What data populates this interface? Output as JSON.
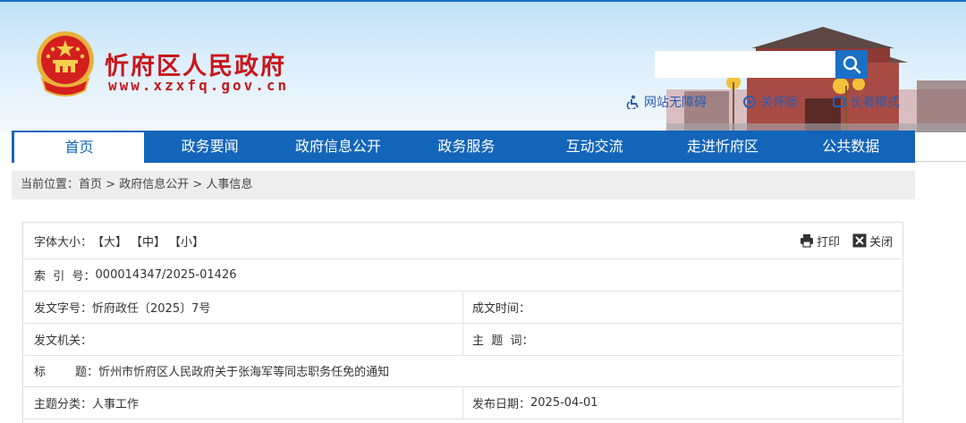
{
  "site": {
    "name": "忻府区人民政府",
    "url": "www.xzxfq.gov.cn"
  },
  "search": {
    "placeholder": ""
  },
  "quick_links": [
    {
      "label": "网站无障碍",
      "icon": "accessibility-icon"
    },
    {
      "label": "关怀版",
      "icon": "care-mode-icon"
    },
    {
      "label": "长者模式",
      "icon": "elder-mode-icon"
    }
  ],
  "nav": [
    {
      "label": "首页"
    },
    {
      "label": "政务要闻"
    },
    {
      "label": "政府信息公开"
    },
    {
      "label": "政务服务"
    },
    {
      "label": "互动交流"
    },
    {
      "label": "走进忻府区"
    },
    {
      "label": "公共数据"
    }
  ],
  "breadcrumb": {
    "prefix": "当前位置：",
    "items": [
      "首页",
      "政府信息公开",
      "人事信息"
    ],
    "separator": " > "
  },
  "toolbar": {
    "font_size_label": "字体大小：",
    "font_large": "【大】",
    "font_medium": "【中】",
    "font_small": "【小】",
    "print_label": "打印",
    "close_label": "关闭"
  },
  "meta": {
    "index_label": "索  引  号：",
    "index_value": "000014347/2025-01426",
    "doc_no_label": "发文字号：",
    "doc_no_value": "忻府政任〔2025〕7号",
    "created_label": "成文时间：",
    "created_value": "",
    "issuer_label": "发文机关：",
    "issuer_value": "",
    "subject_label": "主  题  词：",
    "subject_value": "",
    "title_label": "标        题：",
    "title_value": "忻州市忻府区人民政府关于张海军等同志职务任免的通知",
    "category_label": "主题分类：",
    "category_value": "人事工作",
    "publish_label": "发布日期：",
    "publish_value": "2025-04-01"
  },
  "colors": {
    "brand_blue": "#1365b9",
    "brand_red": "#c8161d"
  }
}
